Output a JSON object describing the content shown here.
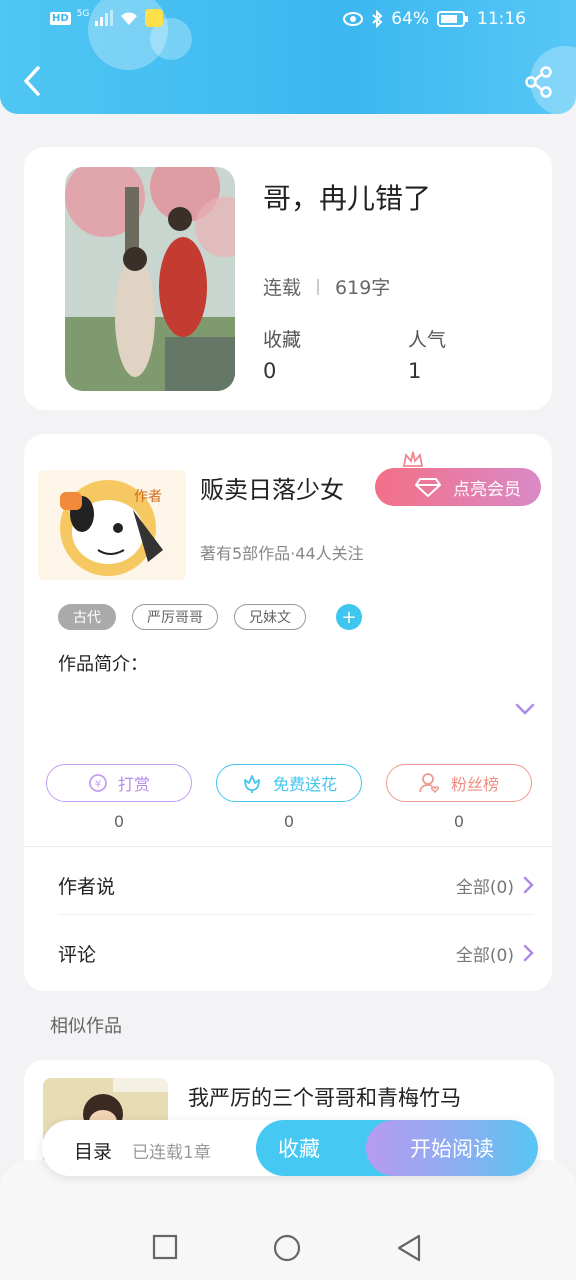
{
  "status_bar": {
    "network_left": "HD",
    "network_type": "5G",
    "battery": "64%",
    "time": "11:16"
  },
  "book": {
    "title": "哥，冉儿错了",
    "status": "连载",
    "word_count": "619字",
    "stats": [
      {
        "label": "收藏",
        "value": "0"
      },
      {
        "label": "人气",
        "value": "1"
      }
    ]
  },
  "author": {
    "name": "贩卖日落少女",
    "sub": "著有5部作品·44人关注",
    "avatar_badge": "作者",
    "vip_button": "点亮会员",
    "tags": [
      "古代",
      "严厉哥哥",
      "兄妹文"
    ],
    "intro_label": "作品简介：",
    "actions": [
      {
        "label": "打赏",
        "count": "0"
      },
      {
        "label": "免费送花",
        "count": "0"
      },
      {
        "label": "粉丝榜",
        "count": "0"
      }
    ],
    "rows": [
      {
        "title": "作者说",
        "right": "全部(0)"
      },
      {
        "title": "评论",
        "right": "全部(0)"
      }
    ]
  },
  "similar": {
    "title": "相似作品",
    "items": [
      {
        "title": "我严厉的三个哥哥和青梅竹马"
      }
    ]
  },
  "bottom_bar": {
    "toc": "目录",
    "toc_sub": "已连载1章",
    "favorite": "收藏",
    "start_reading": "开始阅读"
  },
  "colors": {
    "header": "#3cb7ef",
    "accent": "#45c8f1",
    "vip": "#f36f86",
    "reward": "#b58ae8",
    "fans": "#ee8d80"
  }
}
